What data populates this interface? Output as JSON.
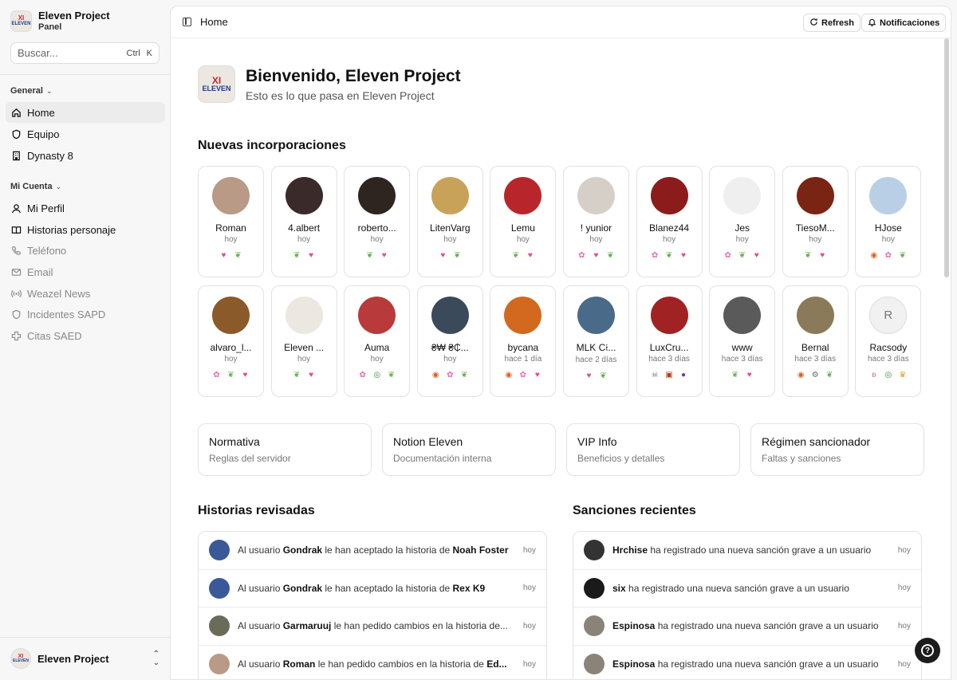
{
  "sidebar": {
    "app_name": "Eleven Project",
    "app_sub": "Panel",
    "search": {
      "placeholder": "Buscar...",
      "kbd1": "Ctrl",
      "kbd2": "K"
    },
    "group_general": "General",
    "general_items": [
      {
        "label": "Home",
        "icon": "home-icon"
      },
      {
        "label": "Equipo",
        "icon": "shield-icon"
      },
      {
        "label": "Dynasty 8",
        "icon": "building-icon"
      }
    ],
    "group_account": "Mi Cuenta",
    "account_items": [
      {
        "label": "Mi Perfil",
        "icon": "user-icon"
      },
      {
        "label": "Historias personaje",
        "icon": "book-icon"
      },
      {
        "label": "Teléfono",
        "icon": "phone-icon"
      },
      {
        "label": "Email",
        "icon": "mail-icon"
      },
      {
        "label": "Weazel News",
        "icon": "broadcast-icon"
      },
      {
        "label": "Incidentes SAPD",
        "icon": "shield-icon"
      },
      {
        "label": "Citas SAED",
        "icon": "cross-icon"
      }
    ],
    "footer_user": "Eleven Project"
  },
  "topbar": {
    "breadcrumb": "Home",
    "refresh": "Refresh",
    "notifications": "Notificaciones"
  },
  "welcome": {
    "title": "Bienvenido, Eleven Project",
    "subtitle": "Esto es lo que pasa en Eleven Project"
  },
  "members_title": "Nuevas incorporaciones",
  "members": [
    {
      "name": "Roman",
      "time": "hoy",
      "color": "#b89a86",
      "badges": [
        "heart",
        "leaf"
      ]
    },
    {
      "name": "4.albert",
      "time": "hoy",
      "color": "#3a2a2a",
      "badges": [
        "leaf",
        "heart"
      ]
    },
    {
      "name": "roberto...",
      "time": "hoy",
      "color": "#2e2520",
      "badges": [
        "leaf",
        "heart"
      ]
    },
    {
      "name": "LitenVarg",
      "time": "hoy",
      "color": "#c9a25a",
      "badges": [
        "heart",
        "leaf"
      ]
    },
    {
      "name": "Lemu",
      "time": "hoy",
      "color": "#b8262b",
      "badges": [
        "leaf",
        "heart"
      ]
    },
    {
      "name": "! yunior",
      "time": "hoy",
      "color": "#d6cfc8",
      "badges": [
        "flower",
        "heart",
        "leaf"
      ]
    },
    {
      "name": "Blanez44",
      "time": "hoy",
      "color": "#8c1c1c",
      "badges": [
        "flower",
        "leaf",
        "heart"
      ]
    },
    {
      "name": "Jes",
      "time": "hoy",
      "color": "#efefef",
      "badges": [
        "flower",
        "leaf",
        "heart"
      ]
    },
    {
      "name": "TiesoM...",
      "time": "hoy",
      "color": "#7a2414",
      "badges": [
        "leaf",
        "heart"
      ]
    },
    {
      "name": "HJose",
      "time": "hoy",
      "color": "#b9cfe6",
      "badges": [
        "target",
        "flower",
        "leaf"
      ]
    },
    {
      "name": "alvaro_l...",
      "time": "hoy",
      "color": "#8a5a2a",
      "badges": [
        "flower",
        "leaf",
        "heart"
      ]
    },
    {
      "name": "Eleven ...",
      "time": "hoy",
      "color": "#ece7e1",
      "badges": [
        "leaf",
        "heart"
      ]
    },
    {
      "name": "Auma",
      "time": "hoy",
      "color": "#b83a3a",
      "badges": [
        "flower",
        "eye",
        "leaf"
      ]
    },
    {
      "name": "₴₩ ₴₵...",
      "time": "hoy",
      "color": "#3a4a5a",
      "badges": [
        "target",
        "flower",
        "leaf"
      ]
    },
    {
      "name": "bycana",
      "time": "hace 1 día",
      "color": "#d2691e",
      "badges": [
        "target",
        "flower",
        "heart"
      ]
    },
    {
      "name": "MLK C𝔦...",
      "time": "hace 2 días",
      "color": "#4a6a8a",
      "badges": [
        "heart",
        "leaf"
      ]
    },
    {
      "name": "LuxCru...",
      "time": "hace 3 días",
      "color": "#a12222",
      "badges": [
        "skull",
        "bag",
        "orb"
      ]
    },
    {
      "name": "www",
      "time": "hace 3 días",
      "color": "#5a5a5a",
      "badges": [
        "leaf",
        "heart"
      ]
    },
    {
      "name": "Bernal",
      "time": "hace 3 días",
      "color": "#8a7a5a",
      "badges": [
        "target",
        "gear",
        "leaf"
      ]
    },
    {
      "name": "Racsody",
      "time": "hace 3 días",
      "initial": "R",
      "color": "#f1f1f1",
      "badges": [
        "bunny",
        "eye",
        "crown"
      ]
    }
  ],
  "quick_links": [
    {
      "title": "Normativa",
      "subtitle": "Reglas del servidor"
    },
    {
      "title": "Notion Eleven",
      "subtitle": "Documentación interna"
    },
    {
      "title": "VIP Info",
      "subtitle": "Beneficios y detalles"
    },
    {
      "title": "Régimen sancionador",
      "subtitle": "Faltas y sanciones"
    }
  ],
  "stories_title": "Historias revisadas",
  "stories": [
    {
      "pre": "Al usuario ",
      "user": "Gondrak",
      "mid": " le han aceptado la historia de ",
      "target": "Noah Foster",
      "time": "hoy",
      "color": "#3b5998"
    },
    {
      "pre": "Al usuario ",
      "user": "Gondrak",
      "mid": " le han aceptado la historia de ",
      "target": "Rex K9",
      "time": "hoy",
      "color": "#3b5998"
    },
    {
      "pre": "Al usuario ",
      "user": "Garmaruuj",
      "mid": " le han pedido cambios en la historia de...",
      "target": "",
      "time": "hoy",
      "color": "#6b6b5a"
    },
    {
      "pre": "Al usuario ",
      "user": "Roman",
      "mid": " le han pedido cambios en la historia de ",
      "target": "Ed...",
      "time": "hoy",
      "color": "#b89a86"
    }
  ],
  "sanctions_title": "Sanciones recientes",
  "sanctions": [
    {
      "user": "Hrchise",
      "text": " ha registrado una nueva sanción grave a un usuario",
      "time": "hoy",
      "color": "#333333"
    },
    {
      "user": "six",
      "text": " ha registrado una nueva sanción grave a un usuario",
      "time": "hoy",
      "color": "#1a1a1a"
    },
    {
      "user": "Espinosa",
      "text": " ha registrado una nueva sanción grave a un usuario",
      "time": "hoy",
      "color": "#8a8378"
    },
    {
      "user": "Espinosa",
      "text": " ha registrado una nueva sanción grave a un usuario",
      "time": "hoy",
      "color": "#8a8378"
    }
  ],
  "colors": {
    "heart": "#e84a8a",
    "leaf": "#5fb34a",
    "flower": "#e86ab0",
    "target": "#e0601c",
    "eye": "#3a8a3a",
    "skull": "#777777",
    "bag": "#b0401c",
    "orb": "#6a3ab0",
    "gear": "#666666",
    "bunny": "#d05a90",
    "crown": "#e0a020"
  }
}
